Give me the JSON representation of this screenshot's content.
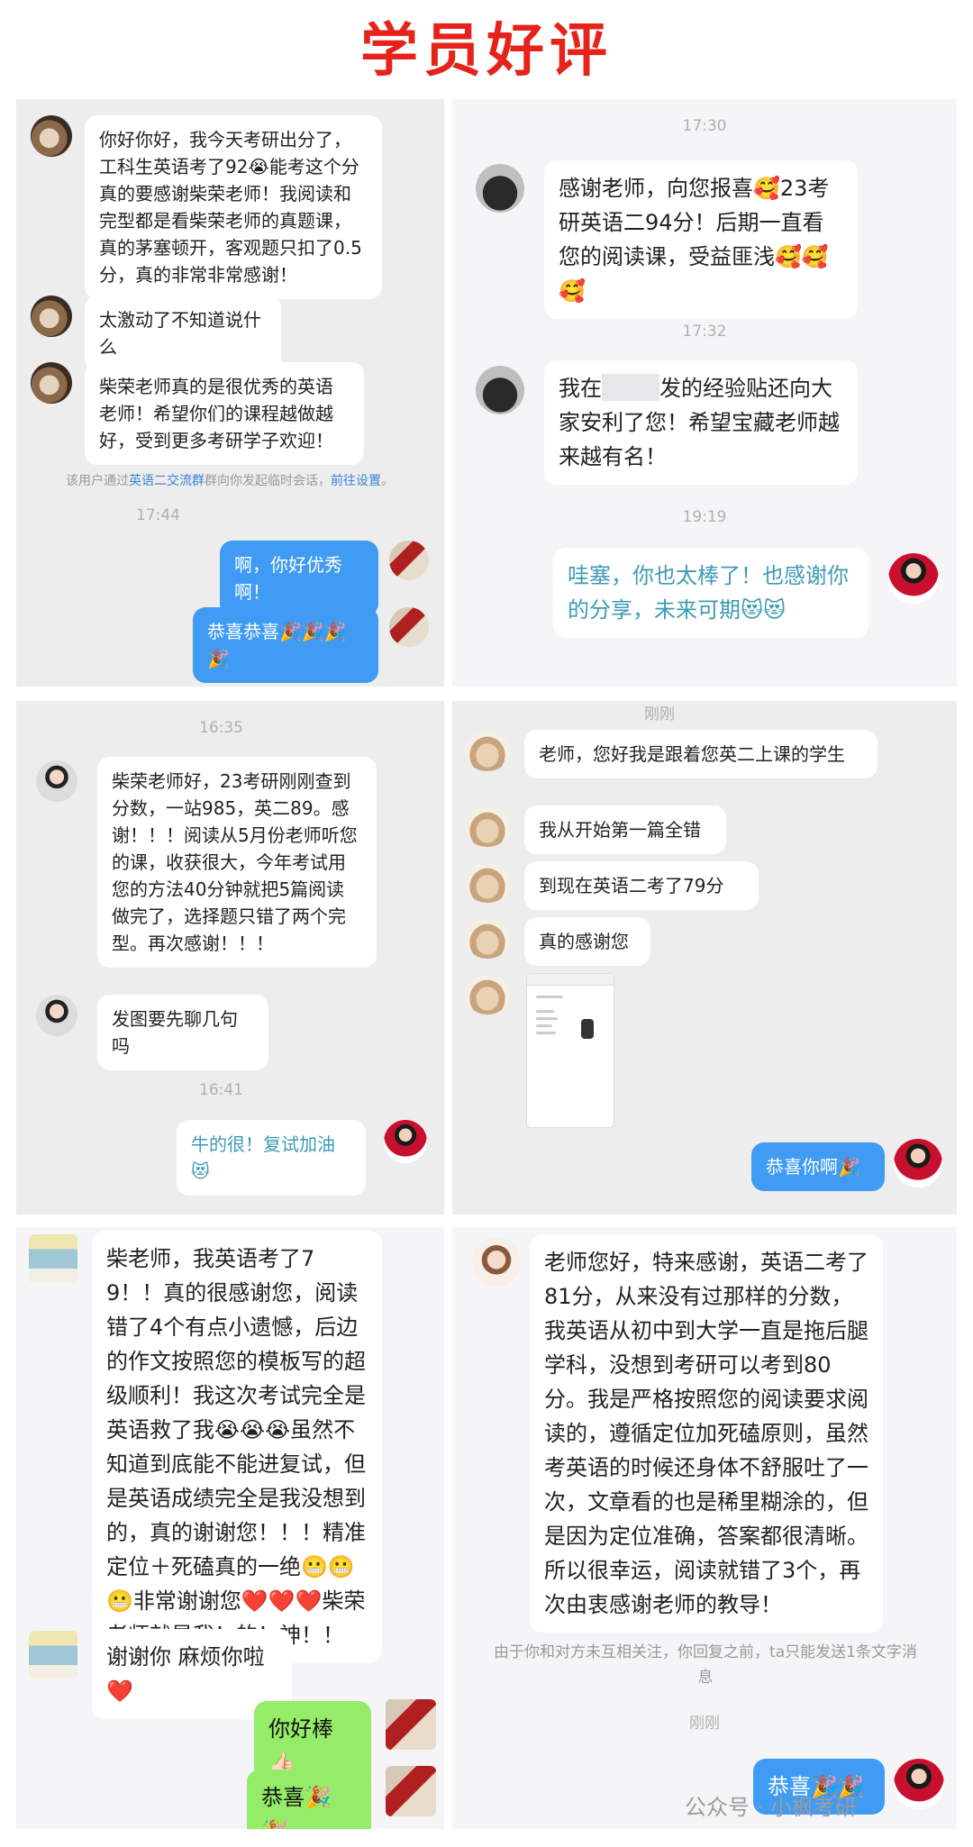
{
  "title": "学员好评",
  "watermark": "公众号 · 小枫考研",
  "panel1": {
    "msg1": "你好你好，我今天考研出分了，工科生英语考了92😭能考这个分真的要感谢柴荣老师！我阅读和完型都是看柴荣老师的真题课，真的茅塞顿开，客观题只扣了0.5分，真的非常非常感谢！",
    "msg2": "太激动了不知道说什么",
    "msg3": "柴荣老师真的是很优秀的英语老师！希望你们的课程越做越好，受到更多考研学子欢迎！",
    "notice_pre": "该用户通过",
    "notice_group": "英语二交流群",
    "notice_mid": "群向你发起临时会话，",
    "notice_link": "前往设置",
    "notice_end": "。",
    "time": "17:44",
    "reply1": "啊，你好优秀啊！",
    "reply2": "恭喜恭喜🎉🎉🎉🎉"
  },
  "panel2": {
    "time1": "17:30",
    "msg1": "感谢老师，向您报喜🥰23考研英语二94分！后期一直看您的阅读课，受益匪浅🥰🥰🥰",
    "time2": "17:32",
    "msg2_pre": "我在",
    "msg2_post": "发的经验贴还向大家安利了您！希望宝藏老师越来越有名！",
    "time3": "19:19",
    "reply": "哇塞，你也太棒了！也感谢你的分享，未来可期😻😻"
  },
  "panel3": {
    "time1": "16:35",
    "msg1": "柴荣老师好，23考研刚刚查到分数，一站985，英二89。感谢！！！阅读从5月份老师听您的课，收获很大，今年考试用您的方法40分钟就把5篇阅读做完了，选择题只错了两个完型。再次感谢！！！",
    "msg2": "发图要先聊几句吗",
    "time2": "16:41",
    "reply": "牛的很！复试加油😻"
  },
  "panel4": {
    "time1": "刚刚",
    "msg1": "老师，您好我是跟着您英二上课的学生",
    "msg2": "我从开始第一篇全错",
    "msg3": "到现在英语二考了79分",
    "msg4": "真的感谢您",
    "reply": "恭喜你啊🎉"
  },
  "panel5": {
    "msg1": "柴老师，我英语考了79！！真的很感谢您，阅读错了4个有点小遗憾，后边的作文按照您的模板写的超级顺利！我这次考试完全是英语救了我😭😭😭虽然不知道到底能不能进复试，但是英语成绩完全是我没想到的，真的谢谢您！！！精准定位＋死磕真的一绝😬😬😬非常谢谢您❤️❤️❤️柴荣老师就是我！的！神！！",
    "msg2": "谢谢你 麻烦你啦❤️",
    "reply1": "你好棒👍🏻",
    "reply2": "恭喜🎉🎉"
  },
  "panel6": {
    "msg1": "老师您好，特来感谢，英语二考了81分，从来没有过那样的分数，我英语从初中到大学一直是拖后腿学科，没想到考研可以考到80分。我是严格按照您的阅读要求阅读的，遵循定位加死磕原则，虽然考英语的时候还身体不舒服吐了一次，文章看的也是稀里糊涂的，但是因为定位准确，答案都很清晰。所以很幸运，阅读就错了3个，再次由衷感谢老师的教导！",
    "notice": "由于你和对方未互相关注，你回复之前，ta只能发送1条文字消息",
    "time": "刚刚",
    "reply": "恭喜🎉🎉"
  }
}
